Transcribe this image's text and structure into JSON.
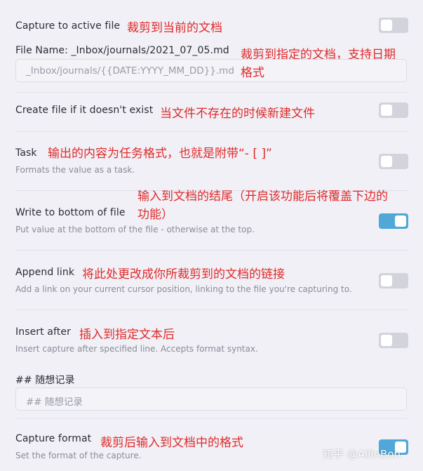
{
  "settings": {
    "capture_active": {
      "label": "Capture to active file",
      "annotation": "裁剪到当前的文档",
      "enabled": false
    },
    "file_name": {
      "label": "File Name: _Inbox/journals/2021_07_05.md",
      "annotation_line1": "裁剪到指定的文档，支持日期",
      "annotation_line2": "格式",
      "value": "_Inbox/journals/{{DATE:YYYY_MM_DD}}.md"
    },
    "create_file": {
      "label": "Create file if it doesn't exist",
      "annotation": "当文件不存在的时候新建文件",
      "enabled": false
    },
    "task": {
      "label": "Task",
      "annotation": "输出的内容为任务格式，也就是附带“- [ ]”",
      "description": "Formats the value as a task.",
      "enabled": false
    },
    "write_bottom": {
      "label": "Write to bottom of file",
      "annotation_line1": "输入到文档的结尾（开启该功能后将覆盖下边的",
      "annotation_line2": "功能）",
      "description": "Put value at the bottom of the file - otherwise at the top.",
      "enabled": true
    },
    "append_link": {
      "label": "Append link",
      "annotation": "将此处更改成你所裁剪到的文档的链接",
      "description": "Add a link on your current cursor position, linking to the file you're capturing to.",
      "enabled": false
    },
    "insert_after": {
      "label": "Insert after",
      "annotation": "插入到指定文本后",
      "description": "Insert capture after specified line. Accepts format syntax.",
      "enabled": false
    },
    "insert_after_value": {
      "label": "## 随想记录",
      "value": "## 随想记录"
    },
    "capture_format": {
      "label": "Capture format",
      "annotation": "裁剪后输入到文档中的格式",
      "description": "Set the format of the capture.",
      "enabled": true
    }
  },
  "watermark": "知乎 @AllinBon",
  "colors": {
    "background": "#f0f0f6",
    "annotation_red": "#e02a2a",
    "toggle_on": "#4fa8d8",
    "toggle_off": "#d3d3db"
  }
}
